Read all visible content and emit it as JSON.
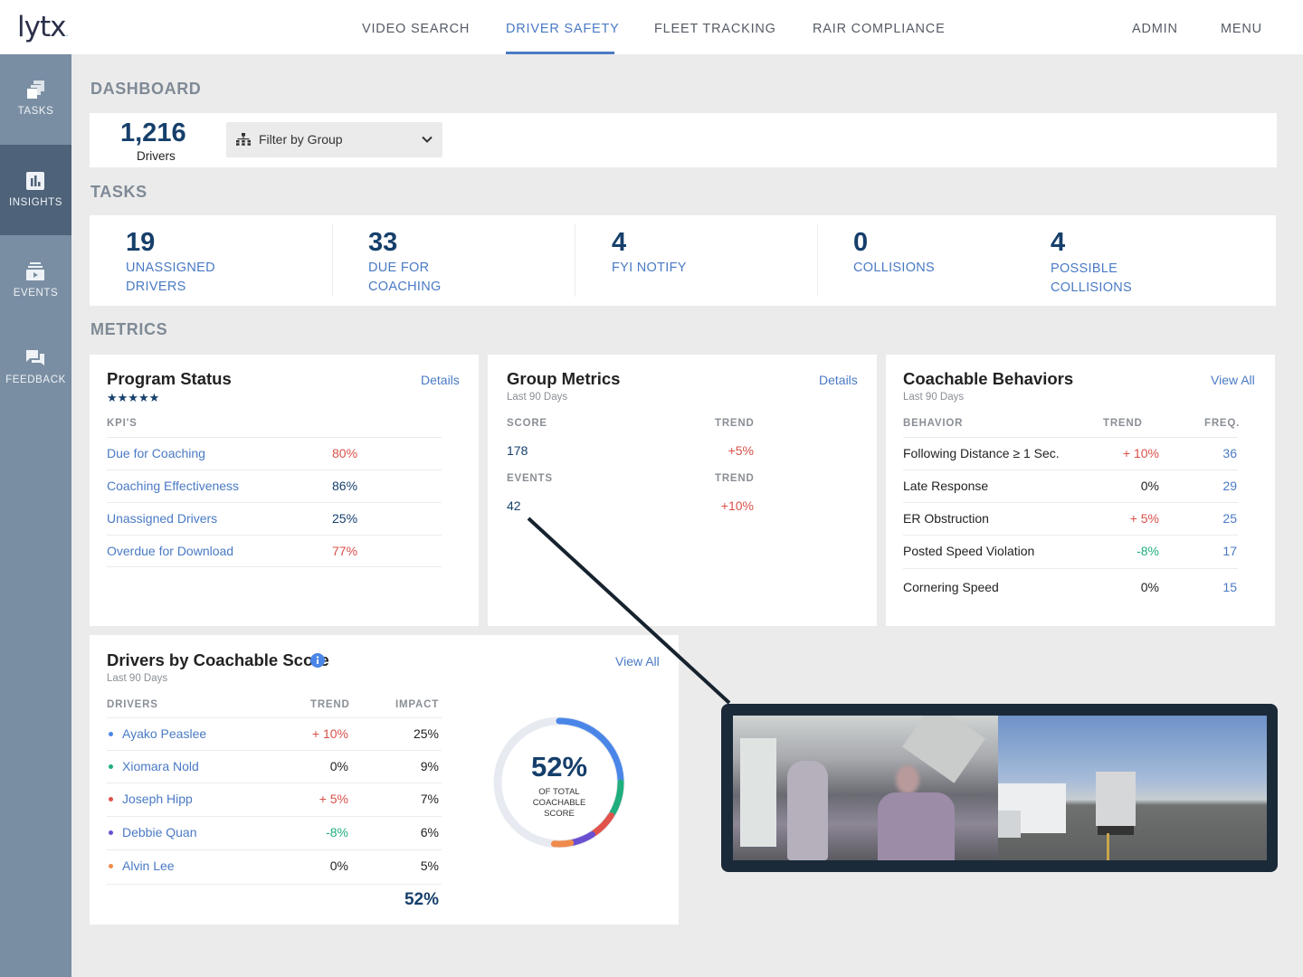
{
  "app": {
    "logo_text": "lytx"
  },
  "topnav": {
    "items": [
      {
        "label": "VIDEO SEARCH",
        "active": false
      },
      {
        "label": "DRIVER SAFETY",
        "active": true
      },
      {
        "label": "FLEET TRACKING",
        "active": false
      },
      {
        "label": "RAIR COMPLIANCE",
        "active": false
      }
    ],
    "admin": "ADMIN",
    "menu": "MENU"
  },
  "sidebar": {
    "items": [
      {
        "label": "TASKS",
        "icon": "tasks-stack-icon",
        "active": false
      },
      {
        "label": "INSIGHTS",
        "icon": "bar-chart-icon",
        "active": true
      },
      {
        "label": "EVENTS",
        "icon": "video-events-icon",
        "active": false
      },
      {
        "label": "FEEDBACK",
        "icon": "chat-bubbles-icon",
        "active": false
      }
    ]
  },
  "dashboard": {
    "title": "DASHBOARD",
    "drivers_count": "1,216",
    "drivers_label": "Drivers",
    "filter": {
      "label": "Filter by Group",
      "icon": "org-chart-icon"
    }
  },
  "tasks": {
    "title": "TASKS",
    "items": [
      {
        "count": "19",
        "label": "UNASSIGNED DRIVERS"
      },
      {
        "count": "33",
        "label": "DUE FOR COACHING"
      },
      {
        "count": "4",
        "label": "FYI NOTIFY"
      },
      {
        "count": "0",
        "label": "COLLISIONS"
      },
      {
        "count": "4",
        "label": "POSSIBLE COLLISIONS"
      }
    ]
  },
  "metrics": {
    "title": "METRICS",
    "program_status": {
      "title": "Program Status",
      "link": "Details",
      "stars": "★★★★★",
      "rating": 5,
      "col_kpi": "KPI'S",
      "rows": [
        {
          "label": "Due for Coaching",
          "value": "80%",
          "status": "bad"
        },
        {
          "label": "Coaching Effectiveness",
          "value": "86%",
          "status": "ok"
        },
        {
          "label": "Unassigned Drivers",
          "value": "25%",
          "status": "ok"
        },
        {
          "label": "Overdue for Download",
          "value": "77%",
          "status": "bad"
        }
      ]
    },
    "group_metrics": {
      "title": "Group Metrics",
      "subtitle": "Last 90 Days",
      "link": "Details",
      "score_label": "SCORE",
      "score_value": "178",
      "score_trend_label": "TREND",
      "score_trend": "+5%",
      "events_label": "EVENTS",
      "events_value": "42",
      "events_trend_label": "TREND",
      "events_trend": "+10%"
    },
    "coachable_behaviors": {
      "title": "Coachable Behaviors",
      "subtitle": "Last 90 Days",
      "link": "View All",
      "columns": [
        "BEHAVIOR",
        "TREND",
        "FREQ."
      ],
      "rows": [
        {
          "behavior": "Following Distance ≥ 1 Sec.",
          "trend": "+ 10%",
          "trend_dir": "up",
          "freq": "36"
        },
        {
          "behavior": "Late Response",
          "trend": "0%",
          "trend_dir": "flat",
          "freq": "29"
        },
        {
          "behavior": "ER Obstruction",
          "trend": "+ 5%",
          "trend_dir": "up",
          "freq": "25"
        },
        {
          "behavior": "Posted Speed Violation",
          "trend": "-8%",
          "trend_dir": "down",
          "freq": "17"
        },
        {
          "behavior": "Cornering Speed",
          "trend": "0%",
          "trend_dir": "flat",
          "freq": "15"
        }
      ]
    },
    "drivers_by_score": {
      "title": "Drivers by Coachable Score",
      "info_icon": "info-icon",
      "subtitle": "Last 90 Days",
      "link": "View All",
      "columns": [
        "DRIVERS",
        "TREND",
        "IMPACT"
      ],
      "rows": [
        {
          "name": "Ayako Peaslee",
          "trend": "+ 10%",
          "trend_dir": "up",
          "impact": "25%",
          "impact_value": 25,
          "color": "#4a86e8"
        },
        {
          "name": "Xiomara Nold",
          "trend": "0%",
          "trend_dir": "flat",
          "impact": "9%",
          "impact_value": 9,
          "color": "#1fae7d"
        },
        {
          "name": "Joseph Hipp",
          "trend": "+ 5%",
          "trend_dir": "up",
          "impact": "7%",
          "impact_value": 7,
          "color": "#e0524a"
        },
        {
          "name": "Debbie Quan",
          "trend": "-8%",
          "trend_dir": "down",
          "impact": "6%",
          "impact_value": 6,
          "color": "#6a4fd0"
        },
        {
          "name": "Alvin Lee",
          "trend": "0%",
          "trend_dir": "flat",
          "impact": "5%",
          "impact_value": 5,
          "color": "#f08a4b"
        }
      ],
      "total": "52%",
      "donut_percent": "52%",
      "donut_caption": [
        "OF TOTAL",
        "COACHABLE",
        "SCORE"
      ]
    }
  },
  "video_preview": {
    "left_view": "driver-cab-camera",
    "right_view": "forward-road-camera"
  },
  "colors": {
    "accent": "#4a7ac4",
    "navy": "#163f6b",
    "sidebar": "#7a8ea3",
    "sidebar_active": "#4e6279",
    "negative": "#d9504a",
    "positive": "#1fae7d"
  }
}
